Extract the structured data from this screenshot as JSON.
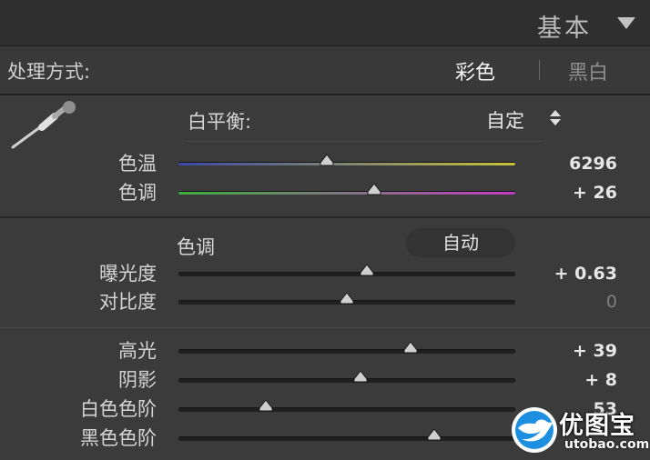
{
  "panel": {
    "title": "基本"
  },
  "treatment": {
    "label": "处理方式:",
    "color_option": "彩色",
    "bw_option": "黑白",
    "selected": "彩色"
  },
  "white_balance": {
    "label": "白平衡:",
    "value": "自定"
  },
  "color_sliders": [
    {
      "key": "temp",
      "label": "色温",
      "value": "6296",
      "level": 0.44
    },
    {
      "key": "tint",
      "label": "色调",
      "value": "+ 26",
      "level": 0.58
    }
  ],
  "tone": {
    "label": "色调",
    "auto_label": "自动"
  },
  "tone_sliders": [
    {
      "key": "exposure",
      "label": "曝光度",
      "value": "+ 0.63",
      "level": 0.56
    },
    {
      "key": "contrast",
      "label": "对比度",
      "value": "0",
      "level": 0.5
    }
  ],
  "presence_sliders": [
    {
      "key": "highlights",
      "label": "高光",
      "value": "+ 39",
      "level": 0.69
    },
    {
      "key": "shadows",
      "label": "阴影",
      "value": "+ 8",
      "level": 0.54
    },
    {
      "key": "whites",
      "label": "白色色阶",
      "value": "53",
      "level": 0.26
    },
    {
      "key": "blacks",
      "label": "黑色色阶",
      "value": "",
      "level": 0.76
    }
  ],
  "watermark": {
    "title": "优图宝",
    "url": "utobao.com"
  },
  "colors": {
    "panel_bg": "#3b3b3b",
    "header_bg": "#2f2f2f",
    "track": "#202020",
    "temp_gradient": [
      "#3a4aa8",
      "#c8c23a"
    ],
    "tint_gradient": [
      "#3fae3f",
      "#c23cc2"
    ],
    "watermark_blue": "#1d8fe0"
  }
}
